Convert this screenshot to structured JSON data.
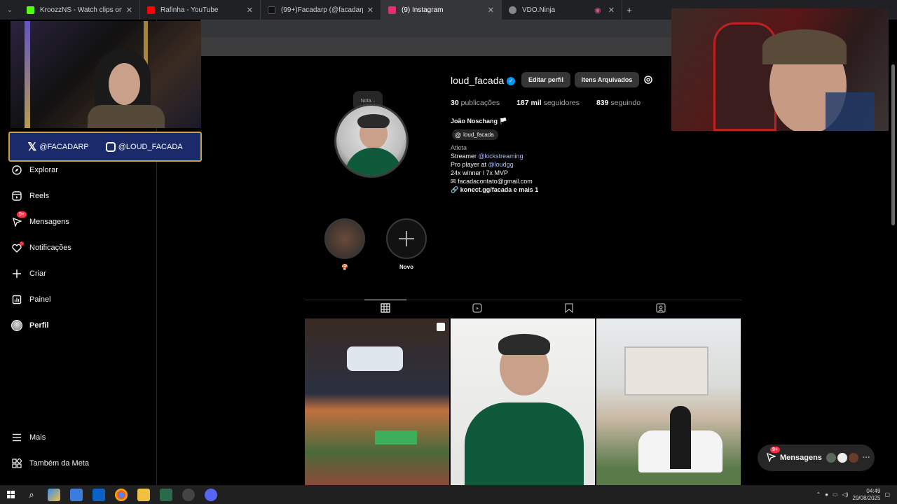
{
  "browser": {
    "tabs": [
      {
        "title": "KroozzNS - Watch clips on Kick",
        "color": "#53fc18"
      },
      {
        "title": "Rafinha - YouTube",
        "color": "#ff0000"
      },
      {
        "title": "(99+)Facadarp (@facadarp) | Ti",
        "color": "#111111"
      },
      {
        "title": "(9) Instagram",
        "color": "#e1306c"
      },
      {
        "title": "VDO.Ninja",
        "color": "#888888"
      }
    ],
    "new_tab": "+",
    "close": "✕"
  },
  "overlay": {
    "x_handle": "@FACADARP",
    "ig_handle": "@LOUD_FACADA"
  },
  "sidebar": {
    "items": [
      {
        "label": "Explorar",
        "icon": "compass-icon"
      },
      {
        "label": "Reels",
        "icon": "reels-icon"
      },
      {
        "label": "Mensagens",
        "icon": "messenger-icon",
        "badge": "9+"
      },
      {
        "label": "Notificações",
        "icon": "heart-icon"
      },
      {
        "label": "Criar",
        "icon": "plus-icon"
      },
      {
        "label": "Painel",
        "icon": "dashboard-icon"
      },
      {
        "label": "Perfil",
        "icon": "avatar"
      }
    ],
    "more": "Mais",
    "meta": "Também da Meta"
  },
  "profile": {
    "note": "Nota...",
    "username": "loud_facada",
    "edit_label": "Editar perfil",
    "archive_label": "Itens Arquivados",
    "posts_count": "30",
    "posts_label": "publicações",
    "followers_count": "187 mil",
    "followers_label": "seguidores",
    "following_count": "839",
    "following_label": "seguindo",
    "full_name": "João Noschang",
    "threads_handle": "loud_facada",
    "category": "Atleta",
    "bio_line1_prefix": "Streamer ",
    "bio_line1_link": "@kickstreaming",
    "bio_line2_prefix": "Pro player at ",
    "bio_line2_link": "@loudgg",
    "bio_line3": "24x winner l 7x MVP",
    "email": "facadacontato@gmail.com",
    "link": "konect.gg/facada e mais 1"
  },
  "highlights": [
    {
      "label": "🍄"
    },
    {
      "label": "Novo"
    }
  ],
  "messages_pill": {
    "badge": "9+",
    "label": "Mensagens"
  },
  "taskbar": {
    "time": "04:49",
    "date": "29/08/2025"
  },
  "colors": {
    "accent": "#0095f6",
    "badge": "#ff3040",
    "link": "#a8b8ff",
    "overlay_bg": "#1b2a6b"
  }
}
